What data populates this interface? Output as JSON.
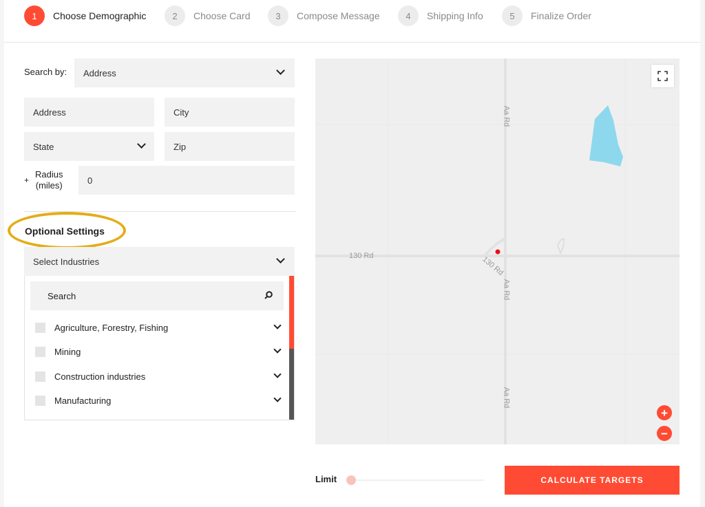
{
  "stepper": {
    "steps": [
      {
        "number": "1",
        "label": "Choose Demographic",
        "active": true
      },
      {
        "number": "2",
        "label": "Choose Card",
        "active": false
      },
      {
        "number": "3",
        "label": "Compose Message",
        "active": false
      },
      {
        "number": "4",
        "label": "Shipping Info",
        "active": false
      },
      {
        "number": "5",
        "label": "Finalize Order",
        "active": false
      }
    ]
  },
  "search": {
    "label": "Search by:",
    "selected": "Address",
    "address_placeholder": "Address",
    "city_placeholder": "City",
    "state_selected": "State",
    "zip_placeholder": "Zip",
    "radius_plus": "+",
    "radius_label_line1": "Radius",
    "radius_label_line2": "(miles)",
    "radius_value": "0"
  },
  "optional": {
    "title": "Optional Settings",
    "industries_select": "Select Industries",
    "search_placeholder": "Search",
    "industries": [
      {
        "label": "Agriculture, Forestry, Fishing"
      },
      {
        "label": "Mining"
      },
      {
        "label": "Construction industries"
      },
      {
        "label": "Manufacturing"
      }
    ]
  },
  "map": {
    "roads": {
      "aa_rd": "Aa Rd",
      "road_130": "130 Rd"
    },
    "zoom_in": "+",
    "zoom_out": "−",
    "colors": {
      "water": "#8ed8ee",
      "pin": "#e8101a"
    }
  },
  "footer": {
    "limit_label": "Limit",
    "limit_value": 0,
    "calculate_label": "CALCULATE TARGETS"
  },
  "colors": {
    "accent": "#ff4b33",
    "highlight": "#e3ad17"
  }
}
